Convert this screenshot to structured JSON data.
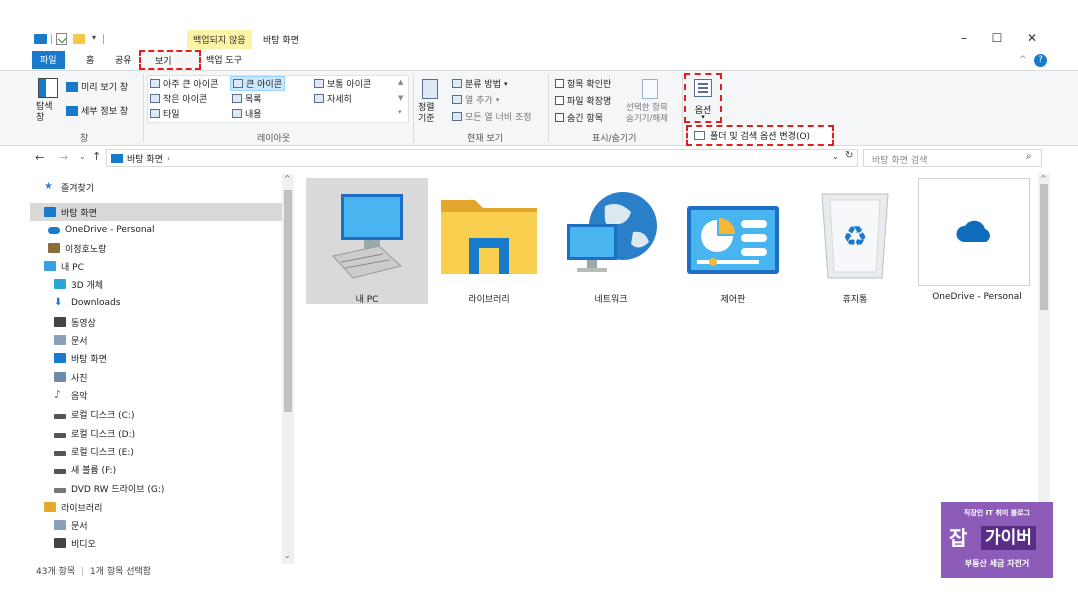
{
  "title_bar": {
    "context_tab_label": "백업되지 않음",
    "window_title": "바탕 화면",
    "minimize": "–",
    "maximize": "☐",
    "close": "✕"
  },
  "ribbon_tabs": {
    "file": "파일",
    "home": "홈",
    "share": "공유",
    "view": "보기",
    "backup_tools": "백업 도구"
  },
  "ribbon": {
    "panes": {
      "nav_pane": "탐색\n창",
      "preview_pane": "미리 보기 창",
      "details_pane": "세부 정보 창",
      "group_label": "창"
    },
    "layout": {
      "extra_large": "아주 큰 아이콘",
      "large": "큰 아이콘",
      "medium": "보통 아이콘",
      "small": "작은 아이콘",
      "list": "목록",
      "details": "자세히",
      "tiles": "타일",
      "content": "내용",
      "group_label": "레이아웃"
    },
    "current_view": {
      "sort_by": "정렬\n기준",
      "group_by": "분류 방법",
      "add_columns": "열 추가",
      "size_all_columns": "모든 열 너비 조정",
      "group_label": "현재 보기"
    },
    "show_hide": {
      "item_checkboxes": "항목 확인란",
      "file_extensions": "파일 확장명",
      "hidden_items": "숨긴 항목",
      "hide_selected": "선택한 항목\n숨기기/해제",
      "group_label": "표시/숨기기"
    },
    "options": {
      "label": "옵션",
      "change_folder_options": "폴더 및 검색 옵션 변경(O)"
    }
  },
  "address_bar": {
    "path": "바탕 화면",
    "search_placeholder": "바탕 화면 검색"
  },
  "nav_pane": {
    "items": [
      {
        "label": "즐겨찾기",
        "icon": "star-icon"
      },
      {
        "label": "바탕 화면",
        "icon": "desktop-icon",
        "selected": true
      },
      {
        "label": "OneDrive - Personal",
        "icon": "cloud-icon"
      },
      {
        "label": "이정호노랑",
        "icon": "user-icon"
      },
      {
        "label": "내 PC",
        "icon": "pc-icon"
      },
      {
        "label": "3D 개체",
        "icon": "cube-icon"
      },
      {
        "label": "Downloads",
        "icon": "download-icon"
      },
      {
        "label": "동영상",
        "icon": "video-icon"
      },
      {
        "label": "문서",
        "icon": "document-icon"
      },
      {
        "label": "바탕 화면",
        "icon": "desktop-icon"
      },
      {
        "label": "사진",
        "icon": "picture-icon"
      },
      {
        "label": "음악",
        "icon": "music-icon"
      },
      {
        "label": "로컬 디스크 (C:)",
        "icon": "drive-c-icon"
      },
      {
        "label": "로컬 디스크 (D:)",
        "icon": "drive-icon"
      },
      {
        "label": "로컬 디스크 (E:)",
        "icon": "drive-icon"
      },
      {
        "label": "새 볼륨 (F:)",
        "icon": "drive-icon"
      },
      {
        "label": "DVD RW 드라이브 (G:)",
        "icon": "dvd-icon"
      },
      {
        "label": "라이브러리",
        "icon": "library-icon"
      },
      {
        "label": "문서",
        "icon": "document-icon"
      },
      {
        "label": "비디오",
        "icon": "video-icon"
      }
    ]
  },
  "content": {
    "items": [
      {
        "label": "내 PC",
        "icon": "pc-icon",
        "selected": true
      },
      {
        "label": "라이브러리",
        "icon": "library-folder-icon"
      },
      {
        "label": "네트워크",
        "icon": "network-icon"
      },
      {
        "label": "제어판",
        "icon": "control-panel-icon"
      },
      {
        "label": "휴지통",
        "icon": "recycle-bin-icon"
      },
      {
        "label": "OneDrive - Personal",
        "icon": "onedrive-icon"
      }
    ]
  },
  "status_bar": {
    "item_count": "43개 항목",
    "selected_count": "1개 항목 선택함"
  },
  "watermark": {
    "top_line": "직장인 IT 취미 블로그",
    "logo_left": "잡",
    "logo_right": "가이버",
    "bottom_line": "부동산 세금 자전거"
  }
}
